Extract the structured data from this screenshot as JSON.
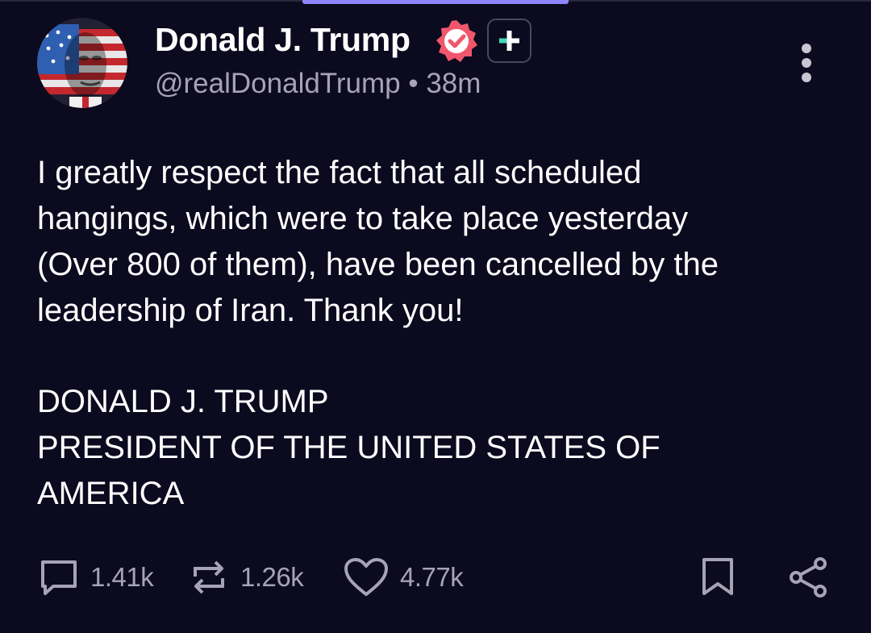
{
  "post": {
    "author": {
      "display_name": "Donald J. Trump",
      "handle": "@realDonaldTrump",
      "time_ago": "38m"
    },
    "handle_line": "@realDonaldTrump • 38m",
    "body": "I greatly respect the fact that all scheduled\nhangings, which were to take place yesterday\n(Over 800 of them), have been cancelled by the\nleadership of Iran. Thank you!",
    "signature": {
      "name": "DONALD J. TRUMP",
      "title_line1": "PRESIDENT OF THE UNITED STATES OF",
      "title_line2": "AMERICA"
    }
  },
  "actions": {
    "replies": "1.41k",
    "reposts": "1.26k",
    "likes": "4.77k"
  },
  "icons": {
    "verified": "verified-badge-icon",
    "plus": "plus-badge-icon",
    "more": "more-vertical-icon",
    "reply": "comment-icon",
    "repost": "repost-icon",
    "like": "heart-icon",
    "bookmark": "bookmark-icon",
    "share": "share-icon"
  },
  "colors": {
    "background": "#0b0a1e",
    "text": "#ffffff",
    "muted": "#a6a3b4",
    "verified": "#f0576d",
    "accent": "#8e86ff",
    "plus_teal": "#46d9b9"
  }
}
